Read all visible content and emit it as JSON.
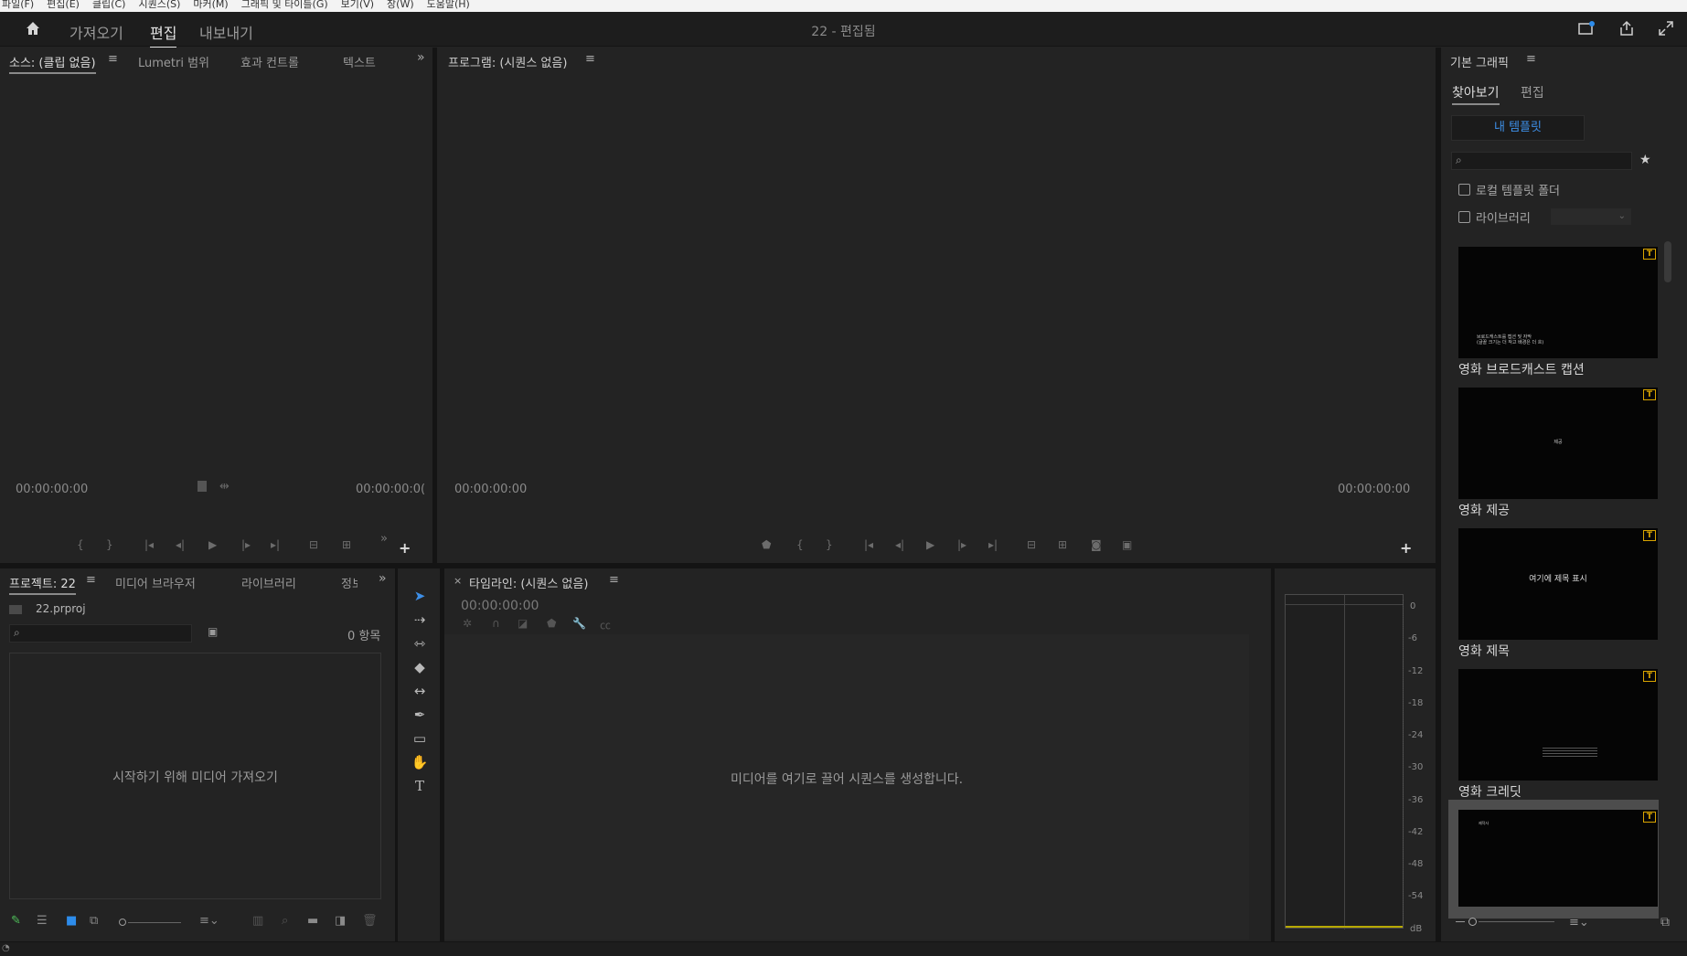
{
  "menubar": [
    "파일(F)",
    "편집(E)",
    "클립(C)",
    "시퀀스(S)",
    "마커(M)",
    "그래픽 및 타이틀(G)",
    "보기(V)",
    "창(W)",
    "도움말(H)"
  ],
  "header": {
    "tabs": [
      "가져오기",
      "편집",
      "내보내기"
    ],
    "title": "22 - 편집됨"
  },
  "source_panel": {
    "tabs": [
      "소스: (클립 없음)",
      "Lumetri 범위",
      "효과 컨트롤",
      "텍스트"
    ],
    "timecode_left": "00:00:00:00",
    "timecode_right": "00:00:00:0("
  },
  "program_panel": {
    "tab": "프로그램: (시퀀스 없음)",
    "timecode_left": "00:00:00:00",
    "timecode_right": "00:00:00:00"
  },
  "project_panel": {
    "tabs": [
      "프로젝트: 22",
      "미디어 브라우저",
      "라이브러리",
      "정보"
    ],
    "file": "22.prproj",
    "item_count": "0 항목",
    "empty_message": "시작하기 위해 미디어 가져오기"
  },
  "timeline_panel": {
    "tab": "타임라인: (시퀀스 없음)",
    "timecode": "00:00:00:00",
    "empty_message": "미디어를 여기로 끌어 시퀀스를 생성합니다."
  },
  "audio_meter": {
    "ticks": [
      "0",
      "-6",
      "-12",
      "-18",
      "-24",
      "-30",
      "-36",
      "-42",
      "-48",
      "-54",
      "dB"
    ]
  },
  "graphics_panel": {
    "title": "기본 그래픽",
    "tabs": [
      "찾아보기",
      "편집"
    ],
    "my_templates_button": "내 템플릿",
    "checkbox_local": "로컬 템플릿 폴더",
    "checkbox_library": "라이브러리",
    "templates": [
      {
        "label": "영화 브로드캐스트 캡션",
        "preview": "브로드캐스트를 캡션 및 자막\n(글꼴 크기는 더 작고 배경은 더 흐)"
      },
      {
        "label": "영화 제공",
        "preview": "제공"
      },
      {
        "label": "영화 제목",
        "preview": "여기에 제목 표시"
      },
      {
        "label": "영화 크레딧",
        "preview": ""
      },
      {
        "label": "",
        "preview": "제작사"
      }
    ]
  }
}
